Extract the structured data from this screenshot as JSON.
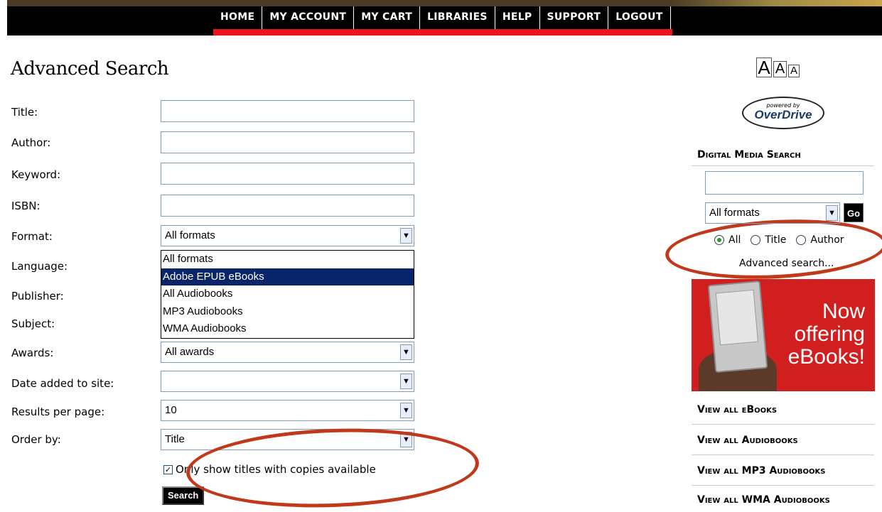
{
  "nav": {
    "items": [
      "HOME",
      "MY ACCOUNT",
      "MY CART",
      "LIBRARIES",
      "HELP",
      "SUPPORT",
      "LOGOUT"
    ]
  },
  "page": {
    "title": "Advanced Search"
  },
  "form": {
    "title_label": "Title:",
    "author_label": "Author:",
    "keyword_label": "Keyword:",
    "isbn_label": "ISBN:",
    "format_label": "Format:",
    "format_value": "All formats",
    "format_options": [
      "All formats",
      "Adobe EPUB eBooks",
      "All Audiobooks",
      "MP3 Audiobooks",
      "WMA Audiobooks"
    ],
    "format_highlighted": "Adobe EPUB eBooks",
    "language_label": "Language:",
    "publisher_label": "Publisher:",
    "subject_label": "Subject:",
    "awards_label": "Awards:",
    "awards_value": "All awards",
    "date_label": "Date added to site:",
    "date_value": "",
    "results_label": "Results per page:",
    "results_value": "10",
    "order_label": "Order by:",
    "order_value": "Title",
    "only_available_label": "Only show titles with copies available",
    "only_available_checked": true,
    "search_button": "Search"
  },
  "sidebar": {
    "text_size_icons": [
      "A",
      "A",
      "A"
    ],
    "powered_by": "powered by",
    "brand": "OverDrive",
    "search_heading": "Digital Media Search",
    "format_value": "All formats",
    "go_button": "Go",
    "radio_options": [
      "All",
      "Title",
      "Author"
    ],
    "radio_selected": "All",
    "advanced_link": "Advanced search...",
    "promo_text": "Now offering eBooks!",
    "links": [
      "View all eBooks",
      "View all Audiobooks",
      "View all MP3 Audiobooks",
      "View all WMA Audiobooks"
    ]
  },
  "colors": {
    "nav_bg": "#000000",
    "nav_accent": "#e8141e",
    "annotation": "#c0391b",
    "selection": "#0a246a",
    "promo_bg": "#d11f1f"
  }
}
